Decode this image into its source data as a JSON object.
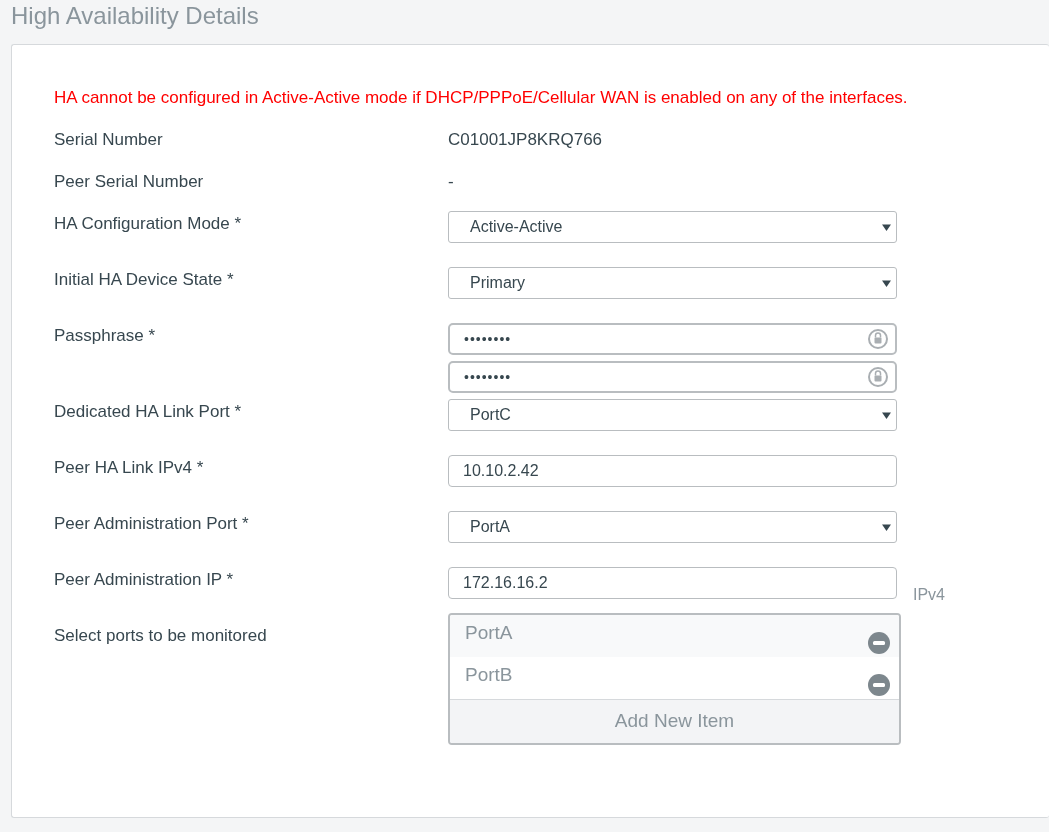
{
  "title": "High Availability Details",
  "warning": "HA cannot be configured in Active-Active mode if DHCP/PPPoE/Cellular WAN is enabled on any of the interfaces.",
  "fields": [
    {
      "kind": "static",
      "label": "Serial Number",
      "value": "C01001JP8KRQ766"
    },
    {
      "kind": "static",
      "label": "Peer Serial Number",
      "value": "-"
    },
    {
      "kind": "select",
      "label": "HA Configuration Mode *",
      "value": "Active-Active"
    },
    {
      "kind": "select",
      "label": "Initial HA Device State *",
      "value": "Primary"
    },
    {
      "kind": "password",
      "label": "Passphrase *",
      "values": [
        "••••••••",
        "••••••••"
      ]
    },
    {
      "kind": "select",
      "label": "Dedicated HA Link Port *",
      "value": "PortC"
    },
    {
      "kind": "text",
      "label": "Peer HA Link IPv4 *",
      "value": "10.10.2.42"
    },
    {
      "kind": "select",
      "label": "Peer Administration Port *",
      "value": "PortA"
    },
    {
      "kind": "text",
      "label": "Peer Administration IP *",
      "value": "172.16.16.2",
      "suffix": "IPv4"
    },
    {
      "kind": "list",
      "label": "Select ports to be monitored",
      "items": [
        "PortA",
        "PortB"
      ],
      "add_label": "Add New Item"
    }
  ]
}
